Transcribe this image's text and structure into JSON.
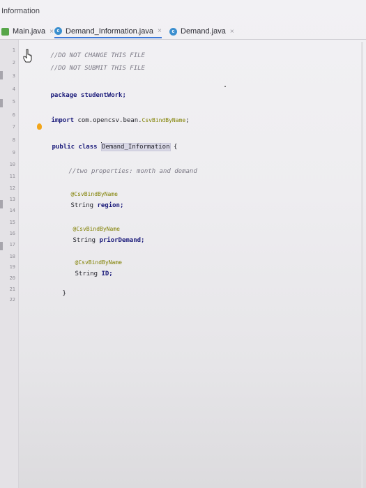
{
  "window": {
    "title": "Information"
  },
  "tabs": [
    {
      "label": "Main.java",
      "close": "×",
      "active": false,
      "icon": "java-file-icon"
    },
    {
      "label": "Demand_Information.java",
      "close": "×",
      "active": true,
      "icon": "class-icon"
    },
    {
      "label": "Demand.java",
      "close": "×",
      "active": false,
      "icon": "class-icon"
    }
  ],
  "gutter": {
    "line_numbers": [
      "1",
      "2",
      "3",
      "4",
      "5",
      "6",
      "7",
      "8",
      "9",
      "10",
      "11",
      "12",
      "13",
      "14",
      "15",
      "16",
      "17",
      "18",
      "19",
      "20",
      "21",
      "22"
    ]
  },
  "code": {
    "comment1": "//DO NOT CHANGE THIS FILE",
    "comment2": "//DO NOT SUBMIT THIS FILE",
    "package_kw": "package",
    "package_name": "studentWork;",
    "import_kw": "import",
    "import_path": "com.opencsv.bean.",
    "import_class": "CsvBindByName",
    "import_end": ";",
    "public_kw": "public",
    "class_kw": "class",
    "class_name": "Demand_Information",
    "open_brace": "{",
    "comment3": "//two properties: month and demand",
    "annotation1": "@CsvBindByName",
    "field1_type": "String",
    "field1_name": "region;",
    "annotation2": "@CsvBindByName",
    "field2_type": "String",
    "field2_name": "priorDemand;",
    "annotation3": "@CsvBindByName",
    "field3_type": "String",
    "field3_name": "ID;",
    "close_brace": "}"
  },
  "icons": {
    "bulb": "lightbulb-icon",
    "cursor": "hand-cursor-icon"
  },
  "colors": {
    "tab_accent": "#3c78d8",
    "keyword": "#1a1a7a",
    "annotation": "#808000",
    "comment": "#7c7a86",
    "bulb": "#f2a51b"
  }
}
